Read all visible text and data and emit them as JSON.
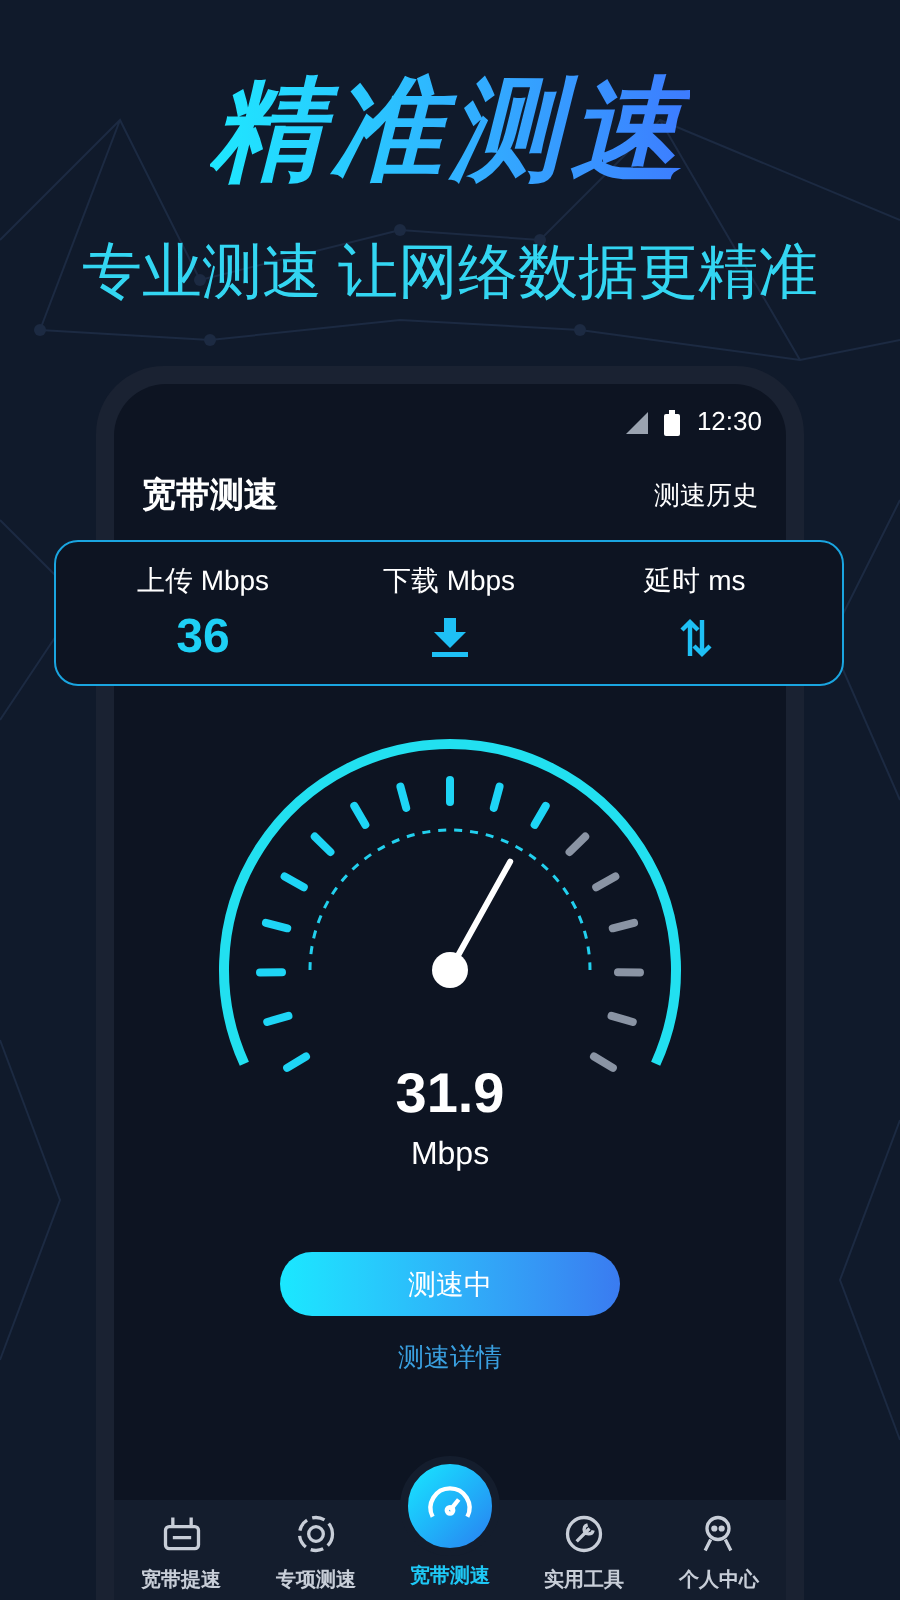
{
  "hero": {
    "title": "精准测速",
    "subtitle": "专业测速 让网络数据更精准"
  },
  "status_bar": {
    "time": "12:30"
  },
  "header": {
    "title": "宽带测速",
    "action": "测速历史"
  },
  "stats": [
    {
      "label": "上传 Mbps",
      "kind": "value",
      "value": "36"
    },
    {
      "label": "下载 Mbps",
      "kind": "download"
    },
    {
      "label": "延时 ms",
      "kind": "swap"
    }
  ],
  "gauge": {
    "reading": "31.9",
    "unit": "Mbps"
  },
  "button": {
    "label": "测速中"
  },
  "link": "测速详情",
  "nav": [
    {
      "label": "宽带提速",
      "selected": false
    },
    {
      "label": "专项测速",
      "selected": false
    },
    {
      "label": "宽带测速",
      "selected": true
    },
    {
      "label": "实用工具",
      "selected": false
    },
    {
      "label": "个人中心",
      "selected": false
    }
  ]
}
